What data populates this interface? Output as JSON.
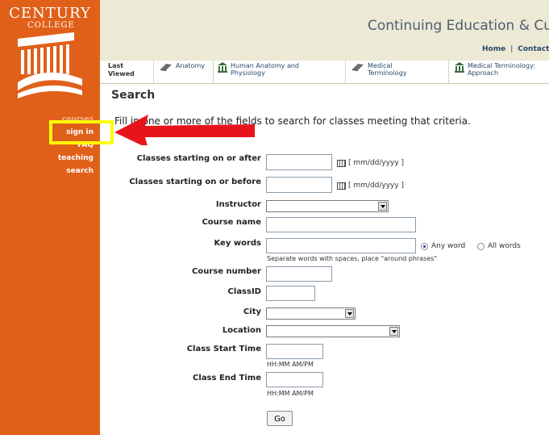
{
  "sidebar": {
    "logo_name": "CENTURY",
    "logo_sub": "COLLEGE",
    "nav": [
      {
        "label": "courses"
      },
      {
        "label": "sign in"
      },
      {
        "label": "FAQ"
      },
      {
        "label": "teaching"
      },
      {
        "label": "search"
      }
    ]
  },
  "header": {
    "title": "Continuing Education & Cu",
    "links": [
      "Home",
      "Contact"
    ],
    "separator": "|"
  },
  "last_viewed": {
    "label_line1": "Last",
    "label_line2": "Viewed",
    "items": [
      {
        "line1": "Anatomy",
        "line2": "",
        "icon": "book-icon"
      },
      {
        "line1": "Human Anatomy and",
        "line2": "Physiology",
        "icon": "building-icon"
      },
      {
        "line1": "Medical",
        "line2": "Terminology",
        "icon": "book-icon"
      },
      {
        "line1": "Medical Terminology:",
        "line2": "Approach",
        "icon": "building-icon"
      }
    ]
  },
  "page": {
    "title": "Search",
    "intro": "Fill in one or more of the fields to search for classes meeting that criteria."
  },
  "form": {
    "start_after_label": "Classes starting on or after",
    "start_before_label": "Classes starting on or before",
    "date_format": "[ mm/dd/yyyy ]",
    "instructor_label": "Instructor",
    "course_name_label": "Course name",
    "keywords_label": "Key words",
    "keywords_hint": "Separate words with spaces, place \"around phrases\"",
    "any_word": "Any word",
    "all_words": "All words",
    "course_number_label": "Course number",
    "class_id_label": "ClassID",
    "city_label": "City",
    "location_label": "Location",
    "start_time_label": "Class Start Time",
    "end_time_label": "Class End Time",
    "time_hint": "HH:MM AM/PM",
    "go_label": "Go"
  },
  "colors": {
    "sidebar": "#e0601a",
    "header": "#ece9d4",
    "highlight": "#ffff00",
    "arrow": "#e8141b"
  }
}
